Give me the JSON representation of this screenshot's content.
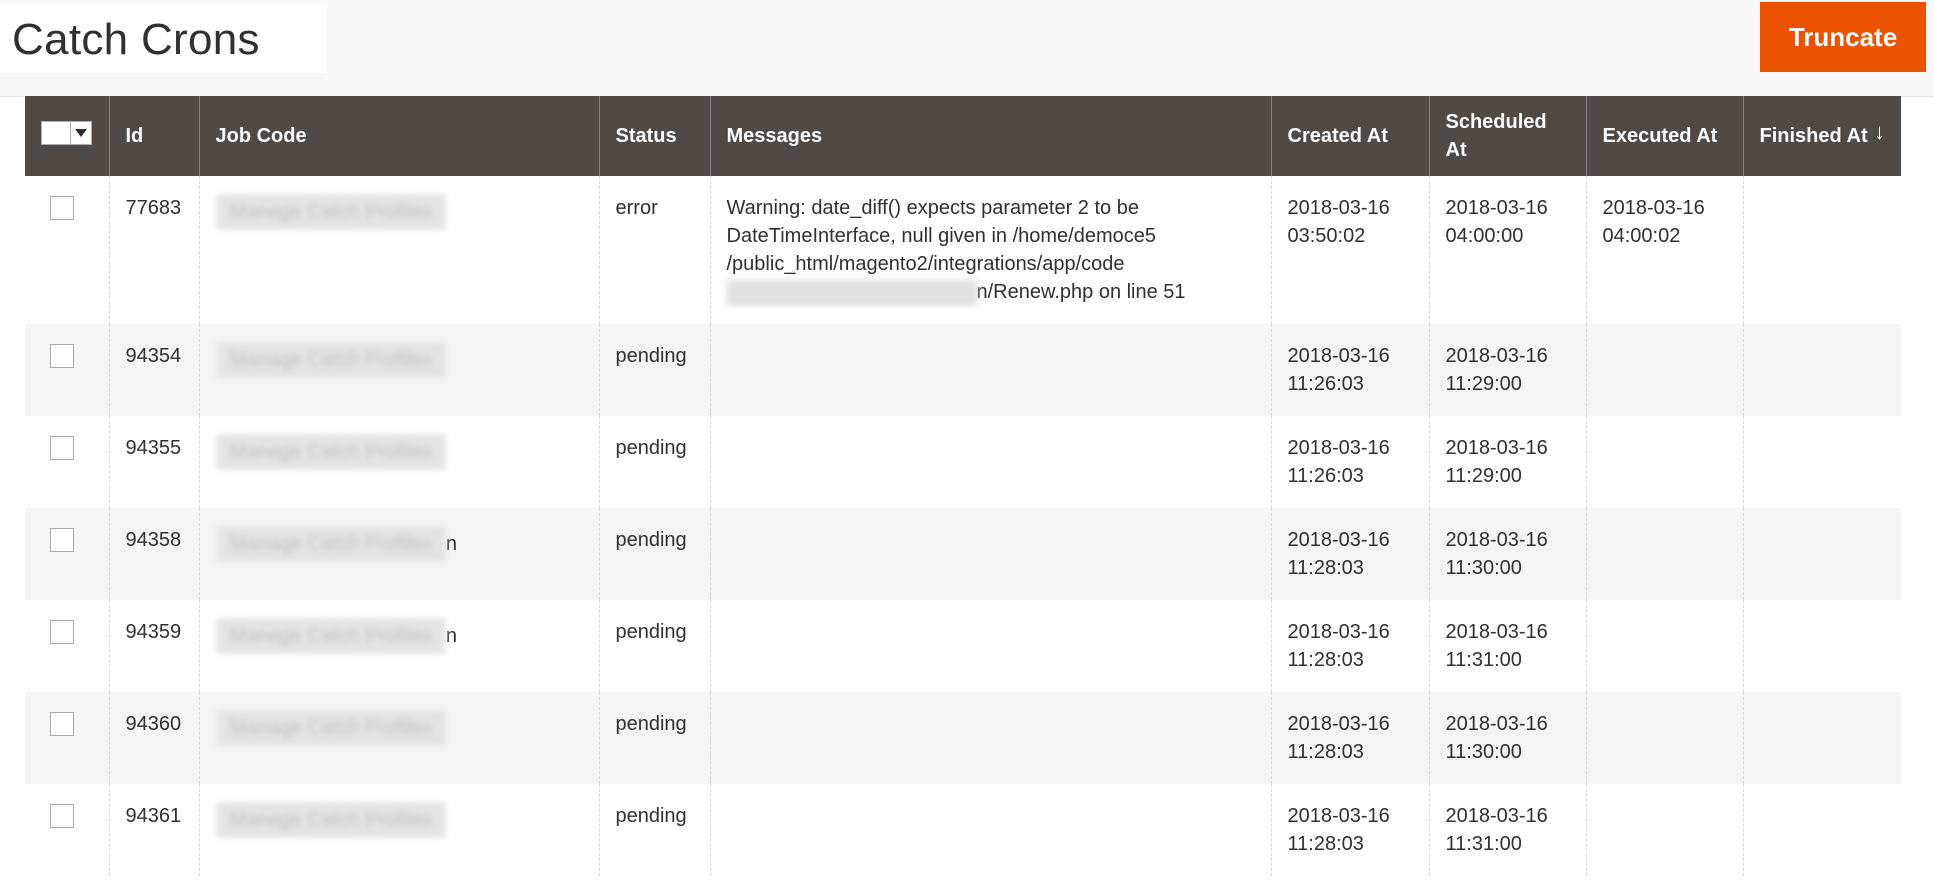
{
  "header": {
    "title": "Catch Crons",
    "truncate_label": "Truncate",
    "accent_color": "#eb5202"
  },
  "grid": {
    "columns": [
      "Id",
      "Job Code",
      "Status",
      "Messages",
      "Created At",
      "Scheduled At",
      "Executed At",
      "Finished At"
    ],
    "sort_indicator": "↓",
    "rows": [
      {
        "id": "77683",
        "job_code": "Manage Catch Profiles",
        "status": "error",
        "message_start": "Warning: date_diff() expects parameter 2 to be DateTimeInterface, null given in /home/democe5 /public_html/magento2/integrations/app/code",
        "message_end": "n/Renew.php on line 51",
        "created": "2018-03-16 03:50:02",
        "scheduled": "2018-03-16 04:00:00",
        "executed": "2018-03-16 04:00:02",
        "finished": ""
      },
      {
        "id": "94354",
        "job_code": "Manage Catch Profiles",
        "status": "pending",
        "created": "2018-03-16 11:26:03",
        "scheduled": "2018-03-16 11:29:00",
        "executed": "",
        "finished": ""
      },
      {
        "id": "94355",
        "job_code": "Manage Catch Profiles",
        "status": "pending",
        "created": "2018-03-16 11:26:03",
        "scheduled": "2018-03-16 11:29:00",
        "executed": "",
        "finished": ""
      },
      {
        "id": "94358",
        "job_code": "Manage Catch Profiles",
        "suffix": "n",
        "status": "pending",
        "created": "2018-03-16 11:28:03",
        "scheduled": "2018-03-16 11:30:00",
        "executed": "",
        "finished": ""
      },
      {
        "id": "94359",
        "job_code": "Manage Catch Profiles",
        "suffix": "n",
        "status": "pending",
        "created": "2018-03-16 11:28:03",
        "scheduled": "2018-03-16 11:31:00",
        "executed": "",
        "finished": ""
      },
      {
        "id": "94360",
        "job_code": "Manage Catch Profiles",
        "status": "pending",
        "created": "2018-03-16 11:28:03",
        "scheduled": "2018-03-16 11:30:00",
        "executed": "",
        "finished": ""
      },
      {
        "id": "94361",
        "job_code": "Manage Catch Profiles",
        "status": "pending",
        "created": "2018-03-16 11:28:03",
        "scheduled": "2018-03-16 11:31:00",
        "executed": "",
        "finished": ""
      }
    ]
  }
}
